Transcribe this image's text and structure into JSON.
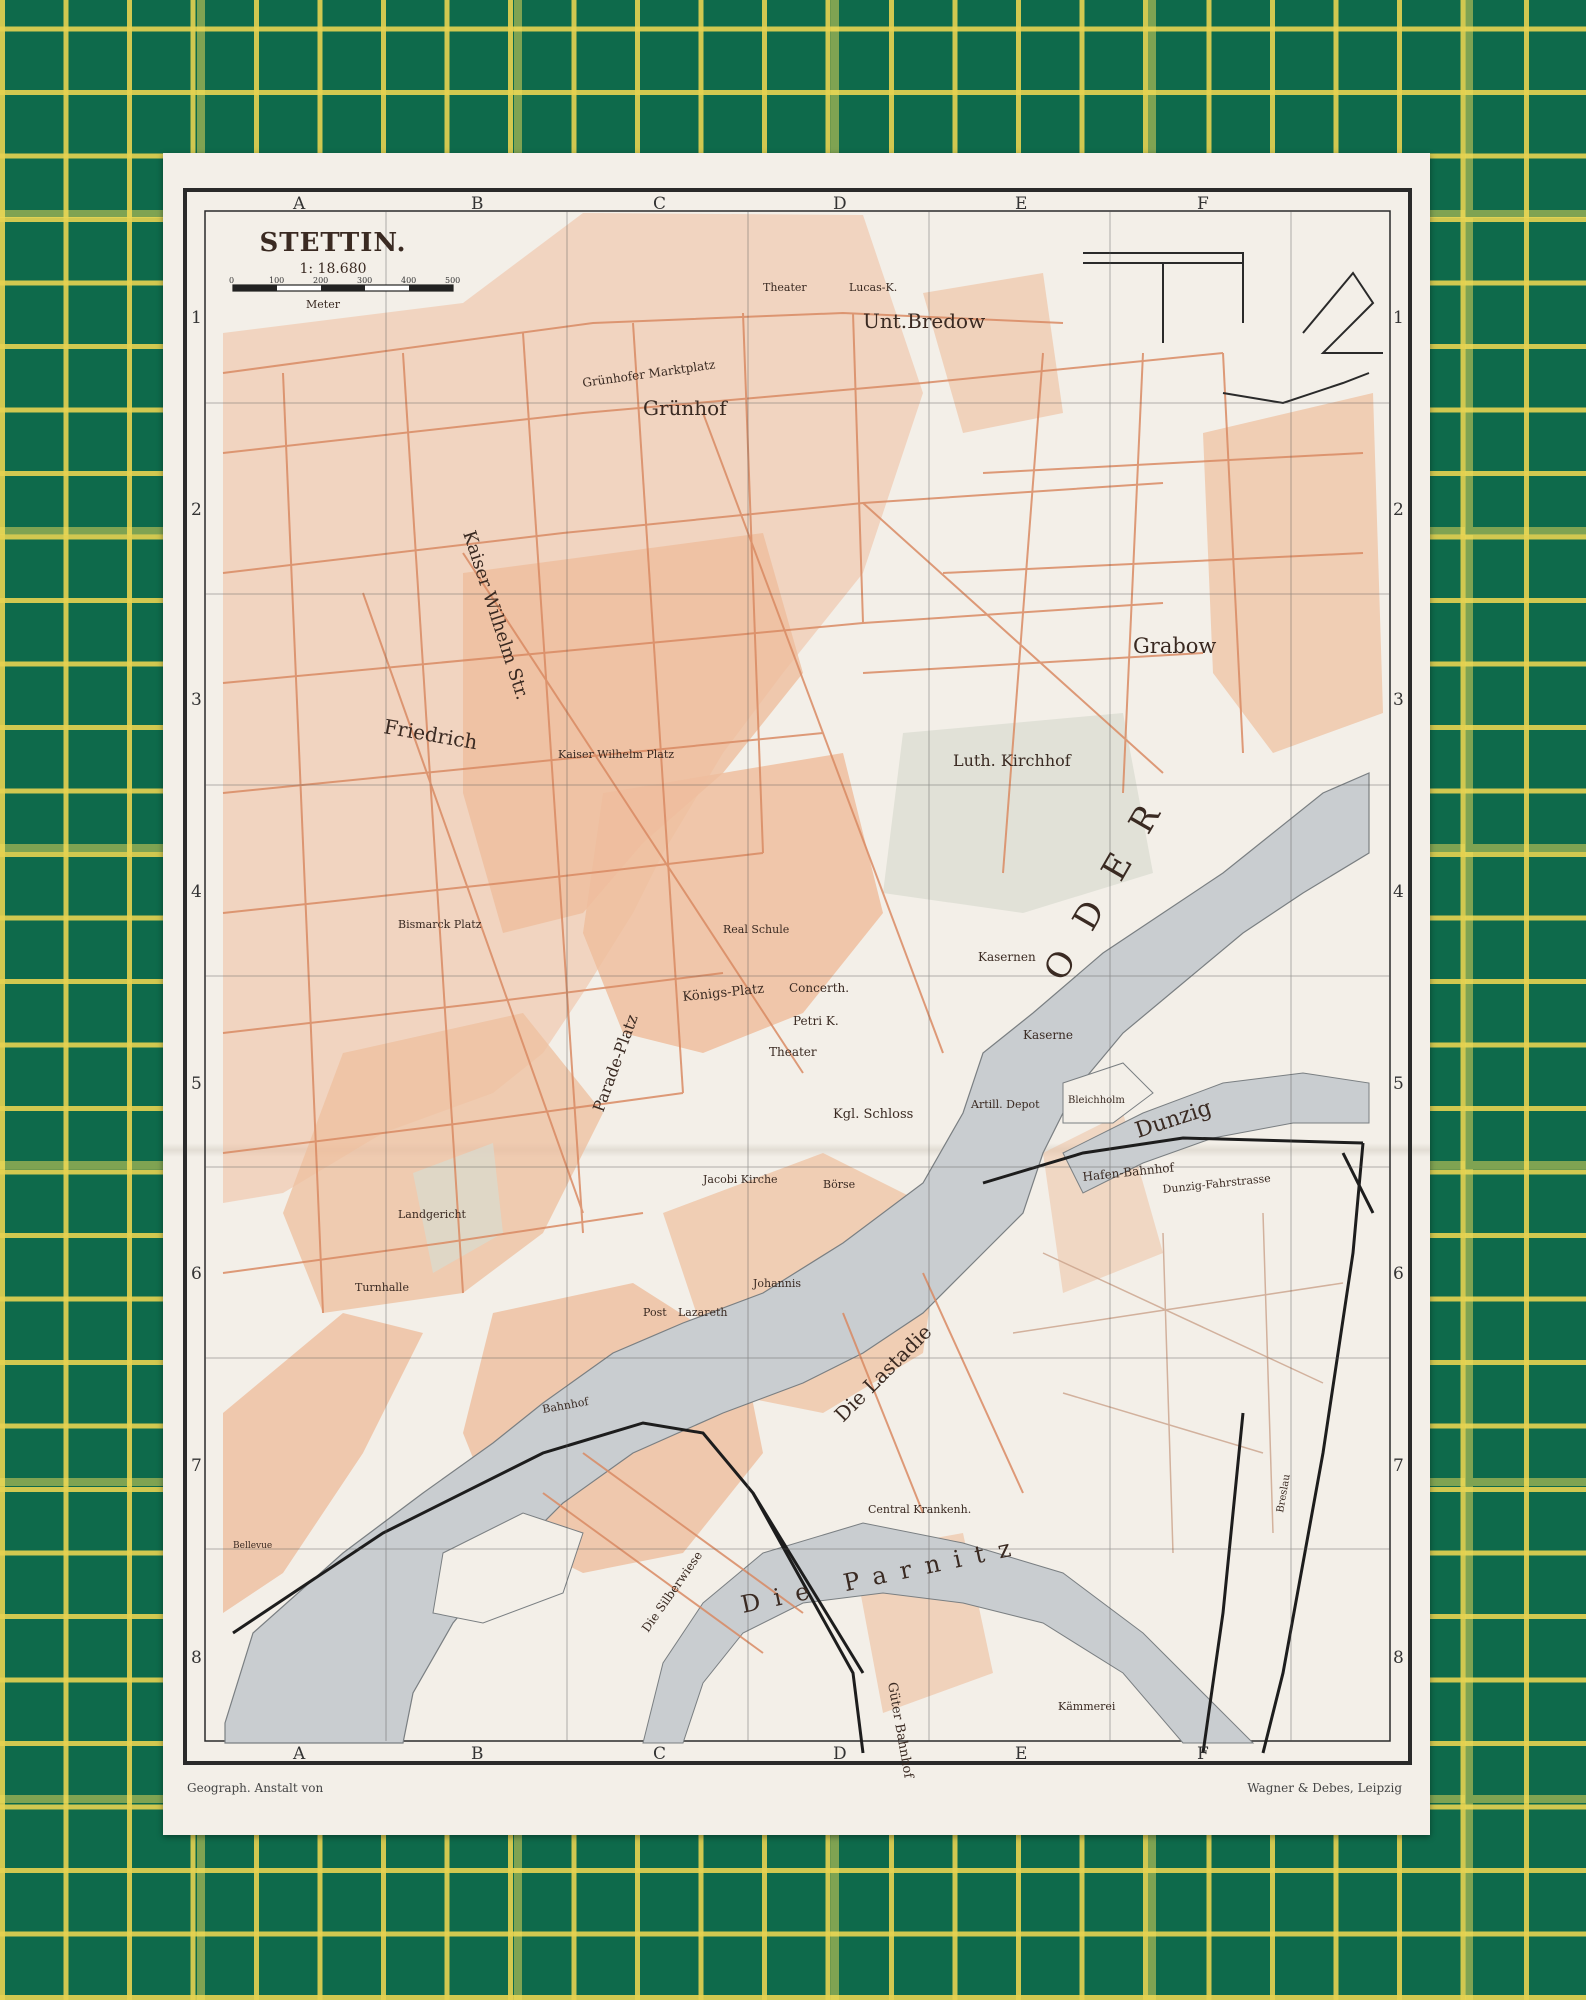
{
  "map": {
    "title": "STETTIN.",
    "scale_text": "1: 18.680",
    "scale_unit": "Meter",
    "scale_ticks": [
      "0",
      "100",
      "200",
      "300",
      "400",
      "500"
    ],
    "columns": [
      "A",
      "B",
      "C",
      "D",
      "E",
      "F"
    ],
    "rows": [
      "1",
      "2",
      "3",
      "4",
      "5",
      "6",
      "7",
      "8"
    ],
    "credit_left": "Geograph. Anstalt von",
    "credit_right": "Wagner & Debes, Leipzig",
    "colors": {
      "paper": "#f3efe8",
      "built_area": "#eebc9a",
      "streets": "#d98a63",
      "water": "#c9cdd0",
      "text": "#3a2a22",
      "mat_green": "#0e6a4b",
      "mat_grid": "#e2ce4a"
    },
    "labels": {
      "unt_bredow": "Unt.Bredow",
      "grunhof": "Grünhof",
      "grunhofer_marktplatz": "Grünhofer Marktplatz",
      "grabow": "Grabow",
      "luth_kirchhof": "Luth. Kirchhof",
      "friedrich": "Friedrich",
      "kaiser_wilhelm_platz": "Kaiser Wilhelm Platz",
      "konigs_platz": "Königs-Platz",
      "parade_platz": "Parade-Platz",
      "bismarck_platz": "Bismarck Platz",
      "kgl_schloss": "Kgl. Schloss",
      "theater": "Theater",
      "concerth": "Concerth.",
      "petri_k": "Petri K.",
      "jacobi_kirche": "Jacobi Kirche",
      "johannis": "Johannis",
      "post": "Post",
      "lazareth": "Lazareth",
      "borse": "Börse",
      "die_lastadie": "Die Lastadie",
      "die_parnitz": "Die Parnitz",
      "die_silberwiese": "Die Silberwiese",
      "oder": "ODER",
      "dunzig": "Dunzig",
      "hafen_bahnhof": "Hafen-Bahnhof",
      "dunzig_fahrstrasse": "Dunzig-Fahrstrasse",
      "bahnhof": "Bahnhof",
      "guter_bahnhof": "Güter Bahnhof",
      "central_krankenh": "Central Krankenh.",
      "kasernen": "Kasernen",
      "kaserne": "Kaserne",
      "turnhalle": "Turnhalle",
      "landgericht": "Landgericht",
      "kaiser_wilhelm_str": "Kaiser Wilhelm Str.",
      "bellevue": "Bellevue",
      "breslau": "Breslau",
      "kammerei": "Kämmerei",
      "bleichholm": "Bleichholm",
      "artill_depot": "Artill. Depot",
      "theater_top": "Theater",
      "lucas_k": "Lucas-K.",
      "real_schule": "Real Schule"
    }
  }
}
